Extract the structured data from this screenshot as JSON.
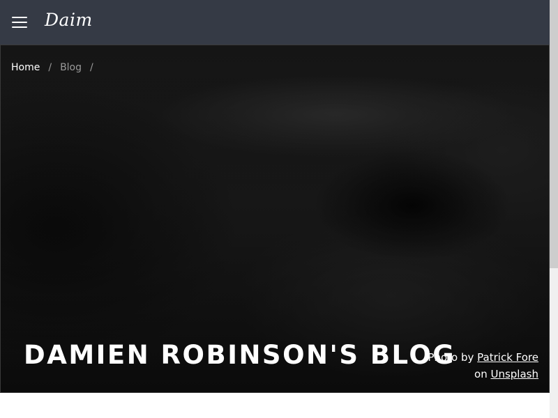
{
  "header": {
    "logo": "Daim",
    "menu_icon": "hamburger-menu-icon",
    "background_color": "#353a45"
  },
  "breadcrumb": {
    "home": "Home",
    "blog": "Blog",
    "separator": "/"
  },
  "hero": {
    "title": "DAMIEN ROBINSON'S BLOG",
    "credit": {
      "prefix": "Photo by",
      "author": "Patrick Fore",
      "middle": "on",
      "source": "Unsplash"
    }
  }
}
